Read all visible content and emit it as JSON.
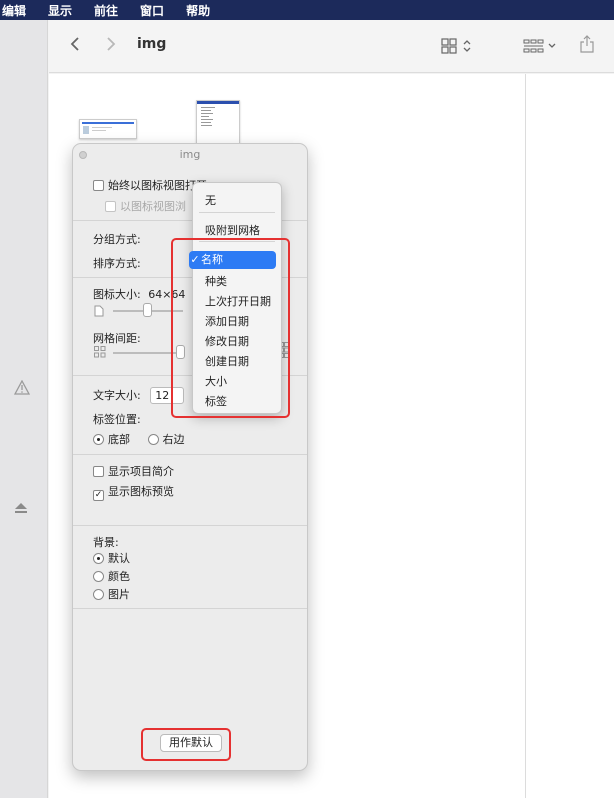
{
  "menubar": {
    "items": [
      "编辑",
      "显示",
      "前往",
      "窗口",
      "帮助"
    ]
  },
  "toolbar": {
    "title": "img",
    "back_icon": "chevron-left-icon",
    "forward_icon": "chevron-right-icon",
    "view_icon": "grid-view-icon",
    "group_icon": "group-by-icon",
    "share_icon": "share-icon"
  },
  "sidebar": {
    "icons": [
      "warning-icon",
      "eject-icon"
    ]
  },
  "panel": {
    "title": "img",
    "always_open_icon_view": "始终以图标视图打开",
    "browse_icon_view": "以图标视图浏",
    "group_by_label": "分组方式:",
    "sort_by_label": "排序方式:",
    "icon_size_label": "图标大小:",
    "icon_size_value": "64×64",
    "grid_spacing_label": "网格间距:",
    "text_size_label": "文字大小:",
    "text_size_value": "12",
    "label_position_label": "标签位置:",
    "label_bottom": "底部",
    "label_right": "右边",
    "show_item_info": "显示项目简介",
    "show_icon_preview": "显示图标预览",
    "background_label": "背景:",
    "bg_default": "默认",
    "bg_color": "颜色",
    "bg_picture": "图片",
    "use_as_defaults": "用作默认"
  },
  "popup": {
    "items": [
      "无",
      "吸附到网格",
      "名称",
      "种类",
      "上次打开日期",
      "添加日期",
      "修改日期",
      "创建日期",
      "大小",
      "标签"
    ],
    "selected": "名称"
  },
  "colors": {
    "selection": "#2d7bf4",
    "highlight": "#e53131",
    "menubar": "#1c2a5b"
  }
}
